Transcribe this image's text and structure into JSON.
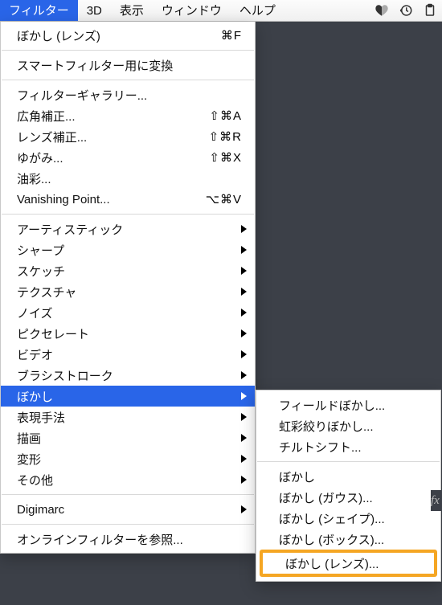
{
  "menubar": {
    "items": [
      "フィルター",
      "3D",
      "表示",
      "ウィンドウ",
      "ヘルプ"
    ],
    "active_index": 0,
    "icons": [
      "heart-split-icon",
      "history-icon",
      "clipboard-icon"
    ]
  },
  "dropdown": {
    "groups": [
      [
        {
          "label": "ぼかし (レンズ)",
          "shortcut": "⌘F"
        }
      ],
      [
        {
          "label": "スマートフィルター用に変換"
        }
      ],
      [
        {
          "label": "フィルターギャラリー..."
        },
        {
          "label": "広角補正...",
          "shortcut": "⇧⌘A"
        },
        {
          "label": "レンズ補正...",
          "shortcut": "⇧⌘R"
        },
        {
          "label": "ゆがみ...",
          "shortcut": "⇧⌘X"
        },
        {
          "label": "油彩..."
        },
        {
          "label": "Vanishing Point...",
          "shortcut": "⌥⌘V"
        }
      ],
      [
        {
          "label": "アーティスティック",
          "submenu": true
        },
        {
          "label": "シャープ",
          "submenu": true
        },
        {
          "label": "スケッチ",
          "submenu": true
        },
        {
          "label": "テクスチャ",
          "submenu": true
        },
        {
          "label": "ノイズ",
          "submenu": true
        },
        {
          "label": "ピクセレート",
          "submenu": true
        },
        {
          "label": "ビデオ",
          "submenu": true
        },
        {
          "label": "ブラシストローク",
          "submenu": true
        },
        {
          "label": "ぼかし",
          "submenu": true,
          "active": true
        },
        {
          "label": "表現手法",
          "submenu": true
        },
        {
          "label": "描画",
          "submenu": true
        },
        {
          "label": "変形",
          "submenu": true
        },
        {
          "label": "その他",
          "submenu": true
        }
      ],
      [
        {
          "label": "Digimarc",
          "submenu": true
        }
      ],
      [
        {
          "label": "オンラインフィルターを参照..."
        }
      ]
    ]
  },
  "submenu": {
    "groups": [
      [
        {
          "label": "フィールドぼかし..."
        },
        {
          "label": "虹彩絞りぼかし..."
        },
        {
          "label": "チルトシフト..."
        }
      ],
      [
        {
          "label": "ぼかし"
        },
        {
          "label": "ぼかし (ガウス)..."
        },
        {
          "label": "ぼかし (シェイプ)..."
        },
        {
          "label": "ぼかし (ボックス)..."
        },
        {
          "label": "ぼかし (レンズ)...",
          "highlighted": true
        }
      ]
    ]
  },
  "right_sliver_glyph": "fx"
}
